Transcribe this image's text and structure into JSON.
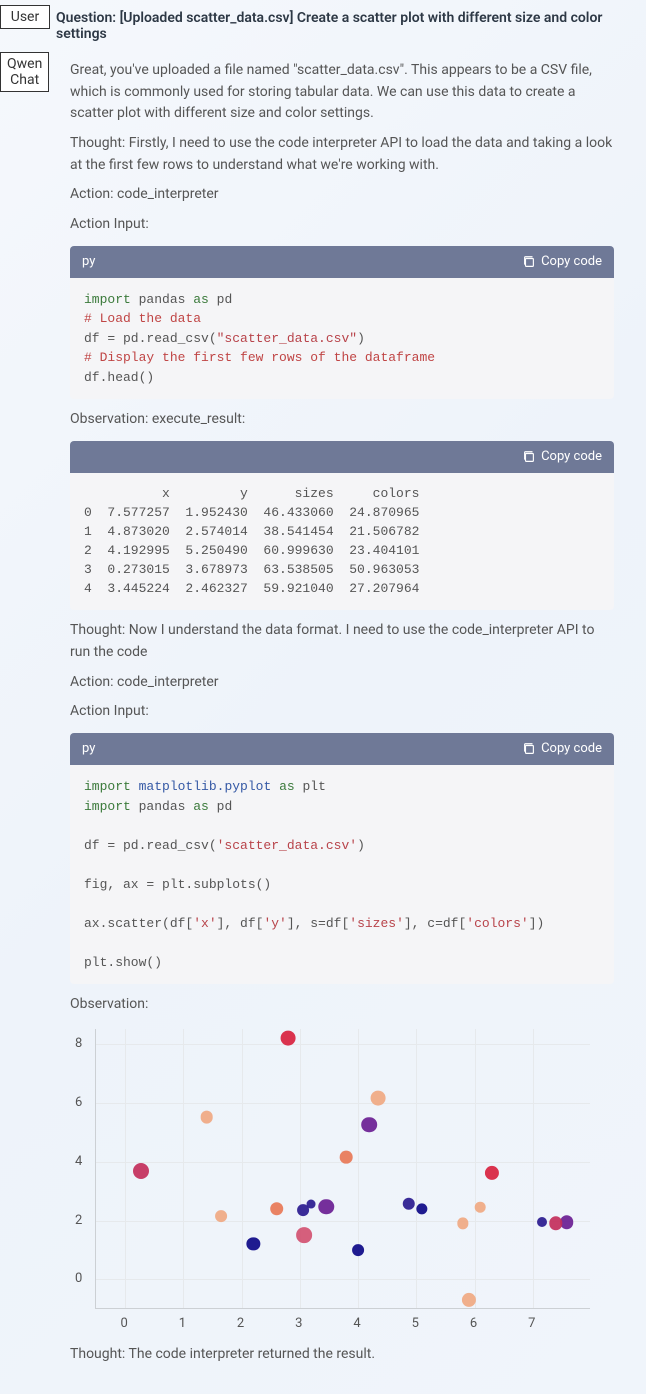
{
  "labels": {
    "user": "User",
    "assistant": "Qwen\nChat"
  },
  "question": "Question: [Uploaded scatter_data.csv] Create a scatter plot with different size and color settings",
  "para1": "Great, you've uploaded a file named \"scatter_data.csv\". This appears to be a CSV file, which is commonly used for storing tabular data. We can use this data to create a scatter plot with different size and color settings.",
  "para2": "Thought: Firstly, I need to use the code interpreter API to load the data and taking a look at the first few rows to understand what we're working with.",
  "action1": "Action: code_interpreter",
  "actioninput1": "Action Input:",
  "code_lang": "py",
  "copy_label": "Copy code",
  "obs1": "Observation: execute_result:",
  "table_header": "          x         y      sizes     colors",
  "table_rows": [
    "0  7.577257  1.952430  46.433060  24.870965",
    "1  4.873020  2.574014  38.541454  21.506782",
    "2  4.192995  5.250490  60.999630  23.404101",
    "3  0.273015  3.678973  63.538505  50.963053",
    "4  3.445224  2.462327  59.921040  27.207964"
  ],
  "para3": "Thought: Now I understand the data format. I need to use the code_interpreter API to run the code",
  "action2": "Action: code_interpreter",
  "actioninput2": "Action Input:",
  "obs2": "Observation:",
  "para4": "Thought: The code interpreter returned the result.",
  "chart_data": {
    "type": "scatter",
    "title": "",
    "xlabel": "",
    "ylabel": "",
    "xlim": [
      -0.5,
      8.0
    ],
    "ylim": [
      -1.0,
      8.5
    ],
    "x_ticks": [
      0,
      1,
      2,
      3,
      4,
      5,
      6,
      7
    ],
    "y_ticks": [
      0,
      2,
      4,
      6,
      8
    ],
    "points": [
      {
        "x": 7.58,
        "y": 1.95,
        "size": 46,
        "color": 24.9
      },
      {
        "x": 4.87,
        "y": 2.57,
        "size": 39,
        "color": 21.5
      },
      {
        "x": 4.19,
        "y": 5.25,
        "size": 61,
        "color": 23.4
      },
      {
        "x": 0.27,
        "y": 3.68,
        "size": 64,
        "color": 51.0
      },
      {
        "x": 3.45,
        "y": 2.46,
        "size": 60,
        "color": 27.2
      },
      {
        "x": 2.8,
        "y": 8.2,
        "size": 55,
        "color": 56.0
      },
      {
        "x": 3.07,
        "y": 1.5,
        "size": 62,
        "color": 45.0
      },
      {
        "x": 4.35,
        "y": 6.15,
        "size": 55,
        "color": 30.0
      },
      {
        "x": 2.2,
        "y": 1.2,
        "size": 44,
        "color": 14.0
      },
      {
        "x": 1.4,
        "y": 5.5,
        "size": 40,
        "color": 30.0
      },
      {
        "x": 1.65,
        "y": 2.15,
        "size": 35,
        "color": 30.0
      },
      {
        "x": 6.3,
        "y": 3.6,
        "size": 50,
        "color": 58.0
      },
      {
        "x": 2.6,
        "y": 2.4,
        "size": 46,
        "color": 35.0
      },
      {
        "x": 4.0,
        "y": 1.0,
        "size": 35,
        "color": 12.0
      },
      {
        "x": 3.8,
        "y": 4.15,
        "size": 40,
        "color": 35.0
      },
      {
        "x": 3.05,
        "y": 2.35,
        "size": 35,
        "color": 16.0
      },
      {
        "x": 5.8,
        "y": 1.9,
        "size": 32,
        "color": 30.0
      },
      {
        "x": 6.1,
        "y": 2.45,
        "size": 28,
        "color": 30.0
      },
      {
        "x": 3.2,
        "y": 2.55,
        "size": 20,
        "color": 16.0
      },
      {
        "x": 7.15,
        "y": 1.95,
        "size": 25,
        "color": 18.0
      },
      {
        "x": 7.4,
        "y": 1.9,
        "size": 45,
        "color": 48.0
      },
      {
        "x": 5.9,
        "y": -0.7,
        "size": 50,
        "color": 30.0
      },
      {
        "x": 5.1,
        "y": 2.4,
        "size": 32,
        "color": 14.0
      }
    ],
    "color_scale": [
      {
        "v": 10,
        "c": "#0d0887"
      },
      {
        "v": 20,
        "c": "#2a1a8f"
      },
      {
        "v": 25,
        "c": "#6a1d93"
      },
      {
        "v": 30,
        "c": "#f0a882"
      },
      {
        "v": 35,
        "c": "#e87756"
      },
      {
        "v": 45,
        "c": "#d35171"
      },
      {
        "v": 50,
        "c": "#c32e5b"
      },
      {
        "v": 58,
        "c": "#d8223f"
      }
    ]
  }
}
